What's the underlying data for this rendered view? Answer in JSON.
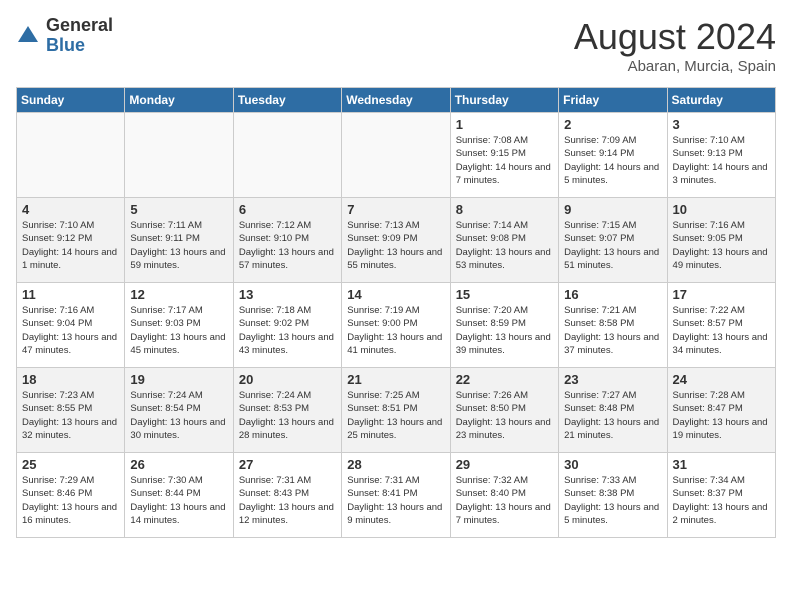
{
  "header": {
    "logo_general": "General",
    "logo_blue": "Blue",
    "month_year": "August 2024",
    "location": "Abaran, Murcia, Spain"
  },
  "days_of_week": [
    "Sunday",
    "Monday",
    "Tuesday",
    "Wednesday",
    "Thursday",
    "Friday",
    "Saturday"
  ],
  "weeks": [
    [
      {
        "day": "",
        "info": ""
      },
      {
        "day": "",
        "info": ""
      },
      {
        "day": "",
        "info": ""
      },
      {
        "day": "",
        "info": ""
      },
      {
        "day": "1",
        "info": "Sunrise: 7:08 AM\nSunset: 9:15 PM\nDaylight: 14 hours and 7 minutes."
      },
      {
        "day": "2",
        "info": "Sunrise: 7:09 AM\nSunset: 9:14 PM\nDaylight: 14 hours and 5 minutes."
      },
      {
        "day": "3",
        "info": "Sunrise: 7:10 AM\nSunset: 9:13 PM\nDaylight: 14 hours and 3 minutes."
      }
    ],
    [
      {
        "day": "4",
        "info": "Sunrise: 7:10 AM\nSunset: 9:12 PM\nDaylight: 14 hours and 1 minute."
      },
      {
        "day": "5",
        "info": "Sunrise: 7:11 AM\nSunset: 9:11 PM\nDaylight: 13 hours and 59 minutes."
      },
      {
        "day": "6",
        "info": "Sunrise: 7:12 AM\nSunset: 9:10 PM\nDaylight: 13 hours and 57 minutes."
      },
      {
        "day": "7",
        "info": "Sunrise: 7:13 AM\nSunset: 9:09 PM\nDaylight: 13 hours and 55 minutes."
      },
      {
        "day": "8",
        "info": "Sunrise: 7:14 AM\nSunset: 9:08 PM\nDaylight: 13 hours and 53 minutes."
      },
      {
        "day": "9",
        "info": "Sunrise: 7:15 AM\nSunset: 9:07 PM\nDaylight: 13 hours and 51 minutes."
      },
      {
        "day": "10",
        "info": "Sunrise: 7:16 AM\nSunset: 9:05 PM\nDaylight: 13 hours and 49 minutes."
      }
    ],
    [
      {
        "day": "11",
        "info": "Sunrise: 7:16 AM\nSunset: 9:04 PM\nDaylight: 13 hours and 47 minutes."
      },
      {
        "day": "12",
        "info": "Sunrise: 7:17 AM\nSunset: 9:03 PM\nDaylight: 13 hours and 45 minutes."
      },
      {
        "day": "13",
        "info": "Sunrise: 7:18 AM\nSunset: 9:02 PM\nDaylight: 13 hours and 43 minutes."
      },
      {
        "day": "14",
        "info": "Sunrise: 7:19 AM\nSunset: 9:00 PM\nDaylight: 13 hours and 41 minutes."
      },
      {
        "day": "15",
        "info": "Sunrise: 7:20 AM\nSunset: 8:59 PM\nDaylight: 13 hours and 39 minutes."
      },
      {
        "day": "16",
        "info": "Sunrise: 7:21 AM\nSunset: 8:58 PM\nDaylight: 13 hours and 37 minutes."
      },
      {
        "day": "17",
        "info": "Sunrise: 7:22 AM\nSunset: 8:57 PM\nDaylight: 13 hours and 34 minutes."
      }
    ],
    [
      {
        "day": "18",
        "info": "Sunrise: 7:23 AM\nSunset: 8:55 PM\nDaylight: 13 hours and 32 minutes."
      },
      {
        "day": "19",
        "info": "Sunrise: 7:24 AM\nSunset: 8:54 PM\nDaylight: 13 hours and 30 minutes."
      },
      {
        "day": "20",
        "info": "Sunrise: 7:24 AM\nSunset: 8:53 PM\nDaylight: 13 hours and 28 minutes."
      },
      {
        "day": "21",
        "info": "Sunrise: 7:25 AM\nSunset: 8:51 PM\nDaylight: 13 hours and 25 minutes."
      },
      {
        "day": "22",
        "info": "Sunrise: 7:26 AM\nSunset: 8:50 PM\nDaylight: 13 hours and 23 minutes."
      },
      {
        "day": "23",
        "info": "Sunrise: 7:27 AM\nSunset: 8:48 PM\nDaylight: 13 hours and 21 minutes."
      },
      {
        "day": "24",
        "info": "Sunrise: 7:28 AM\nSunset: 8:47 PM\nDaylight: 13 hours and 19 minutes."
      }
    ],
    [
      {
        "day": "25",
        "info": "Sunrise: 7:29 AM\nSunset: 8:46 PM\nDaylight: 13 hours and 16 minutes."
      },
      {
        "day": "26",
        "info": "Sunrise: 7:30 AM\nSunset: 8:44 PM\nDaylight: 13 hours and 14 minutes."
      },
      {
        "day": "27",
        "info": "Sunrise: 7:31 AM\nSunset: 8:43 PM\nDaylight: 13 hours and 12 minutes."
      },
      {
        "day": "28",
        "info": "Sunrise: 7:31 AM\nSunset: 8:41 PM\nDaylight: 13 hours and 9 minutes."
      },
      {
        "day": "29",
        "info": "Sunrise: 7:32 AM\nSunset: 8:40 PM\nDaylight: 13 hours and 7 minutes."
      },
      {
        "day": "30",
        "info": "Sunrise: 7:33 AM\nSunset: 8:38 PM\nDaylight: 13 hours and 5 minutes."
      },
      {
        "day": "31",
        "info": "Sunrise: 7:34 AM\nSunset: 8:37 PM\nDaylight: 13 hours and 2 minutes."
      }
    ]
  ]
}
